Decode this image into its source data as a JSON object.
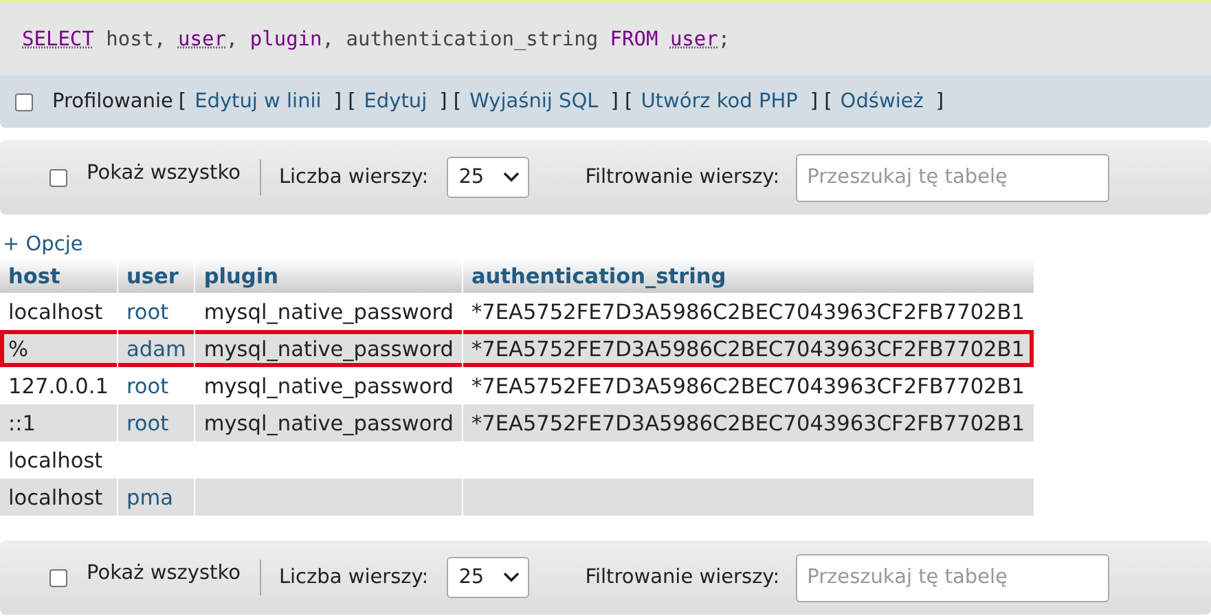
{
  "sql_query": {
    "tokens": [
      {
        "text": "SELECT",
        "kind": "keyword",
        "linked": true
      },
      {
        "text": " host, ",
        "kind": "plain",
        "linked": false
      },
      {
        "text": "user",
        "kind": "keyword",
        "linked": true
      },
      {
        "text": ", ",
        "kind": "plain",
        "linked": false
      },
      {
        "text": "plugin",
        "kind": "keyword",
        "linked": false
      },
      {
        "text": ", authentication_string ",
        "kind": "plain",
        "linked": false
      },
      {
        "text": "FROM ",
        "kind": "keyword",
        "linked": false
      },
      {
        "text": "user",
        "kind": "keyword",
        "linked": true
      },
      {
        "text": ";",
        "kind": "plain",
        "linked": false
      }
    ]
  },
  "query_actions": {
    "profiling": {
      "label": "Profilowanie",
      "checked": false
    },
    "links": [
      {
        "before": "[",
        "label": "Edytuj w linii"
      },
      {
        "before": "] [",
        "label": "Edytuj"
      },
      {
        "before": "] [",
        "label": "Wyjaśnij SQL"
      },
      {
        "before": "] [",
        "label": "Utwórz kod PHP"
      },
      {
        "before": "] [",
        "label": "Odśwież"
      }
    ],
    "end": "]"
  },
  "nav_bars": [
    {
      "show_all": {
        "label": "Pokaż wszystko",
        "checked": false
      },
      "rows_label": "Liczba wierszy:",
      "rows_value": "25",
      "filter_label": "Filtrowanie wierszy:",
      "filter_placeholder": "Przeszukaj tę tabelę"
    },
    {
      "show_all": {
        "label": "Pokaż wszystko",
        "checked": false
      },
      "rows_label": "Liczba wierszy:",
      "rows_value": "25",
      "filter_label": "Filtrowanie wierszy:",
      "filter_placeholder": "Przeszukaj tę tabelę"
    }
  ],
  "options_link": "+ Opcje",
  "table": {
    "columns": [
      "host",
      "user",
      "plugin",
      "authentication_string"
    ],
    "rows": [
      {
        "cells": [
          "localhost",
          "root",
          "mysql_native_password",
          "*7EA5752FE7D3A5986C2BEC7043963CF2FB7702B1"
        ],
        "highlighted": false
      },
      {
        "cells": [
          "%",
          "adam",
          "mysql_native_password",
          "*7EA5752FE7D3A5986C2BEC7043963CF2FB7702B1"
        ],
        "highlighted": true
      },
      {
        "cells": [
          "127.0.0.1",
          "root",
          "mysql_native_password",
          "*7EA5752FE7D3A5986C2BEC7043963CF2FB7702B1"
        ],
        "highlighted": false
      },
      {
        "cells": [
          "::1",
          "root",
          "mysql_native_password",
          "*7EA5752FE7D3A5986C2BEC7043963CF2FB7702B1"
        ],
        "highlighted": false
      },
      {
        "cells": [
          "localhost",
          "",
          "",
          ""
        ],
        "highlighted": false
      },
      {
        "cells": [
          "localhost",
          "pma",
          "",
          ""
        ],
        "highlighted": false
      }
    ]
  }
}
